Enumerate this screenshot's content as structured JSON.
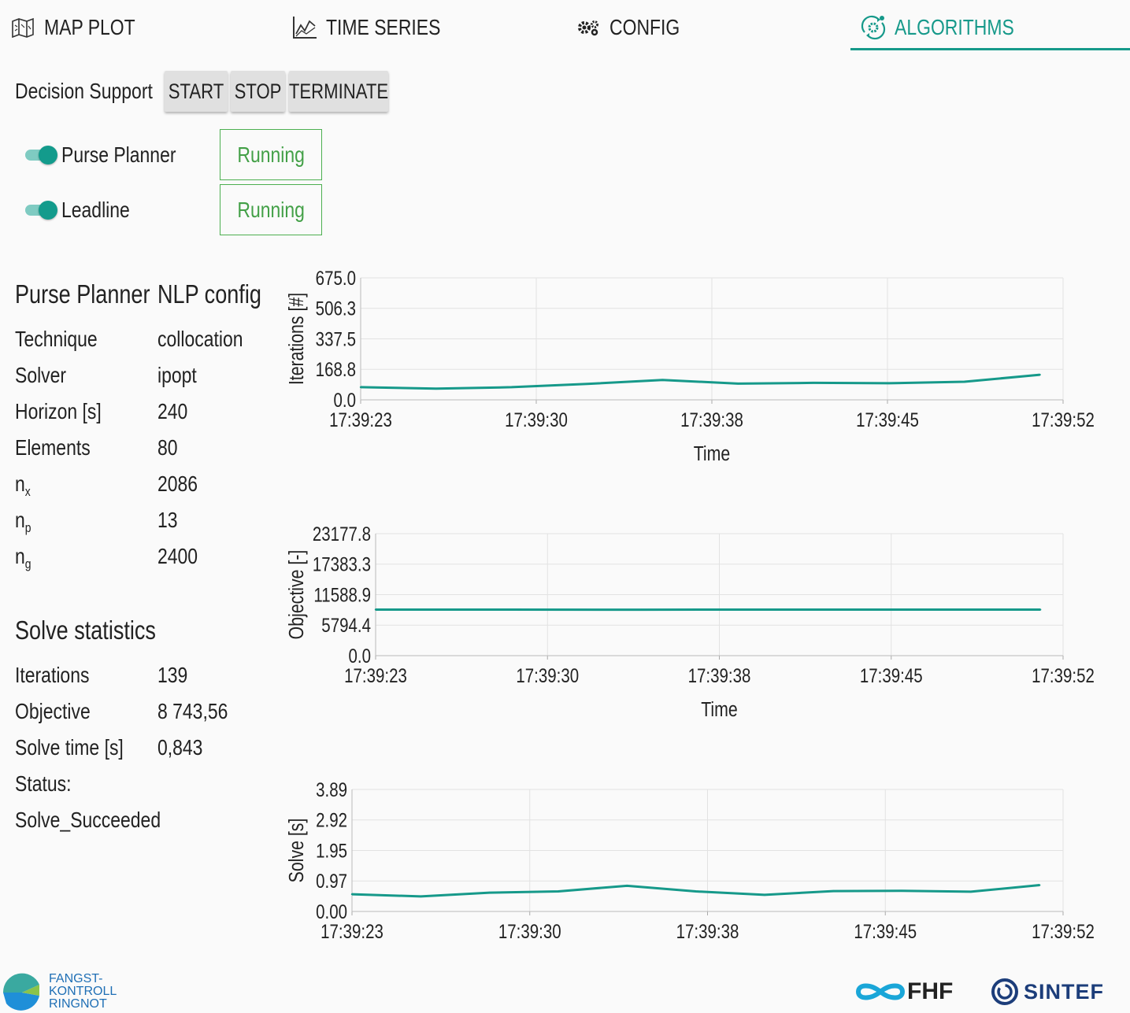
{
  "tabs": [
    {
      "label": "MAP PLOT",
      "icon": "map-icon"
    },
    {
      "label": "TIME SERIES",
      "icon": "chart-line-icon"
    },
    {
      "label": "CONFIG",
      "icon": "gears-icon"
    },
    {
      "label": "ALGORITHMS",
      "icon": "cog-sync-icon",
      "active": true
    }
  ],
  "decision_support": {
    "label": "Decision Support",
    "start_label": "START",
    "stop_label": "STOP",
    "terminate_label": "TERMINATE"
  },
  "algorithms": [
    {
      "name": "Purse Planner",
      "enabled": true,
      "status": "Running"
    },
    {
      "name": "Leadline",
      "enabled": true,
      "status": "Running"
    }
  ],
  "nlp_config": {
    "title": "Purse Planner",
    "title_value": "NLP config",
    "rows": [
      {
        "key": "Technique",
        "value": "collocation"
      },
      {
        "key": "Solver",
        "value": "ipopt"
      },
      {
        "key": "Horizon [s]",
        "value": "240"
      },
      {
        "key": "Elements",
        "value": "80"
      },
      {
        "key": "n",
        "sub": "x",
        "value": "2086"
      },
      {
        "key": "n",
        "sub": "p",
        "value": "13"
      },
      {
        "key": "n",
        "sub": "g",
        "value": "2400"
      }
    ]
  },
  "solve_statistics": {
    "title": "Solve statistics",
    "rows": [
      {
        "key": "Iterations",
        "value": "139"
      },
      {
        "key": "Objective",
        "value": "8 743,56"
      },
      {
        "key": "Solve time [s]",
        "value": "0,843"
      }
    ],
    "status_label": "Status:",
    "status_value": "Solve_Succeeded"
  },
  "colors": {
    "accent": "#16998a",
    "running": "#43a047",
    "line": "#16998a"
  },
  "chart_data": [
    {
      "type": "line",
      "ylabel": "Iterations [#]",
      "xlabel": "Time",
      "yticks": [
        "0.0",
        "168.8",
        "337.5",
        "506.3",
        "675.0"
      ],
      "ylim": [
        0,
        675
      ],
      "xticks": [
        "17:39:23",
        "17:39:30",
        "17:39:38",
        "17:39:45",
        "17:39:52"
      ],
      "x": [
        0,
        0.06,
        0.25,
        0.5,
        0.69,
        0.91,
        1.05,
        1.19,
        1.35,
        1.53
      ],
      "y": [
        70,
        62,
        70,
        88,
        110,
        90,
        94,
        92,
        100,
        139
      ],
      "grid": true
    },
    {
      "type": "line",
      "ylabel": "Objective [-]",
      "xlabel": "Time",
      "yticks": [
        "0.0",
        "5794.4",
        "11588.9",
        "17383.3",
        "23177.8"
      ],
      "ylim": [
        0,
        23177.8
      ],
      "xticks": [
        "17:39:23",
        "17:39:30",
        "17:39:38",
        "17:39:45",
        "17:39:52"
      ],
      "x": [
        0,
        0.15,
        0.5,
        0.9,
        1.2,
        1.55
      ],
      "y": [
        8750,
        8740,
        8735,
        8745,
        8748,
        8743
      ],
      "grid": true
    },
    {
      "type": "line",
      "ylabel": "Solve [s]",
      "xlabel": "",
      "yticks": [
        "0.00",
        "0.97",
        "1.95",
        "2.92",
        "3.89"
      ],
      "ylim": [
        0,
        3.89
      ],
      "xticks": [
        "17:39:23",
        "17:39:30",
        "17:39:38",
        "17:39:45",
        "17:39:52"
      ],
      "x": [
        0,
        0.2,
        0.55,
        0.85,
        1.15,
        1.4,
        1.6,
        1.85,
        2.1,
        2.4
      ],
      "y": [
        0.55,
        0.48,
        0.6,
        0.64,
        0.82,
        0.64,
        0.53,
        0.65,
        0.66,
        0.63,
        0.84
      ],
      "grid": true
    }
  ],
  "footer": {
    "logo_left_lines": [
      "FANGST-",
      "KONTROLL",
      "RINGNOT"
    ],
    "logo_fhf": "FHF",
    "logo_sintef": "SINTEF"
  }
}
